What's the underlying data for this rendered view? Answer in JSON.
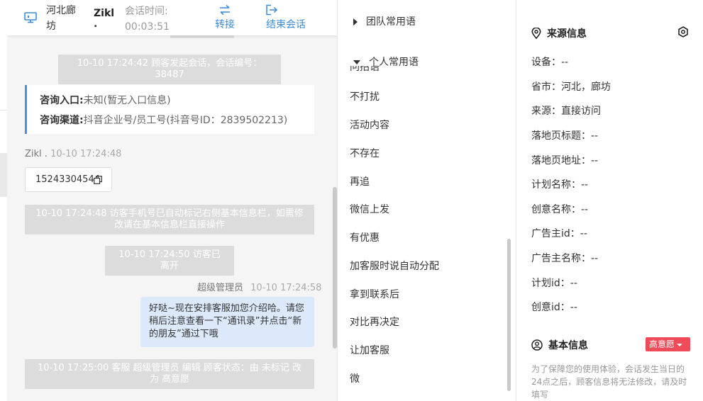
{
  "header": {
    "location": "河北廊坊",
    "visitor_name": "Zikl",
    "visitor_dot": ".",
    "time_label": "会话时间:",
    "time_value": "00:03:51",
    "transfer_label": "转接",
    "end_label": "结束会话"
  },
  "chat": {
    "sys_start": "10-10 17:24:42 顾客发起会话，会话编号：38487",
    "card_entry_label": "咨询入口:",
    "card_entry_value": "未知(暂无入口信息)",
    "card_channel_label": "咨询渠道:",
    "card_channel_value": "抖音企业号/员工号(抖音号ID：2839502213)",
    "visitor_name": "Zikl .",
    "visitor_time": "10-10 17:24:48",
    "visitor_phone": "15243304544",
    "sys_autotag_line1": "10-10 17:24:48 访客手机号已自动标记右侧基本信息栏，如需修",
    "sys_autotag_line2": "改请在基本信息栏直接操作",
    "sys_left": "10-10 17:24:50 访客已离开",
    "agent_name": "超级管理员",
    "agent_time": "10-10 17:24:58",
    "agent_message": "好哒~现在安排客服加您介绍哈。请您稍后注意查看一下“通讯录”并点击“新的朋友”通过下哦",
    "sys_status_line1": "10-10 17:25:00 客服 超级管理员 编辑 顾客状态：由 未标记 改",
    "sys_status_line2": "为 高意愿"
  },
  "phrases": {
    "team_group": "团队常用语",
    "personal_group": "个人常用语",
    "clipped_item": "问招语",
    "items": [
      "不打扰",
      "活动内容",
      "不存在",
      "再追",
      "微信上发",
      "有优惠",
      "加客服时说自动分配",
      "拿到联系后",
      "对比再决定",
      "让加客服",
      "微"
    ]
  },
  "info": {
    "source_title": "来源信息",
    "rows": [
      "设备：--",
      "省市：河北，廊坊",
      "来源：直接访问",
      "落地页标题：--",
      "落地页地址：--",
      "计划名称：--",
      "创意名称：--",
      "广告主id：--",
      "广告主名称：--",
      "计划id：--",
      "创意id：--"
    ],
    "basic_title": "基本信息",
    "intent_badge": "高意愿",
    "note": "为了保障您的使用体验，会话发生当日的24点之后，顾客信息将无法修改，请及时填写"
  },
  "colors": {
    "accent": "#3a8bd8",
    "card_border": "#4a90e2",
    "agent_bubble": "#dbe9fb",
    "badge": "#ef4b58",
    "system_msg": "#dcdcdc"
  }
}
